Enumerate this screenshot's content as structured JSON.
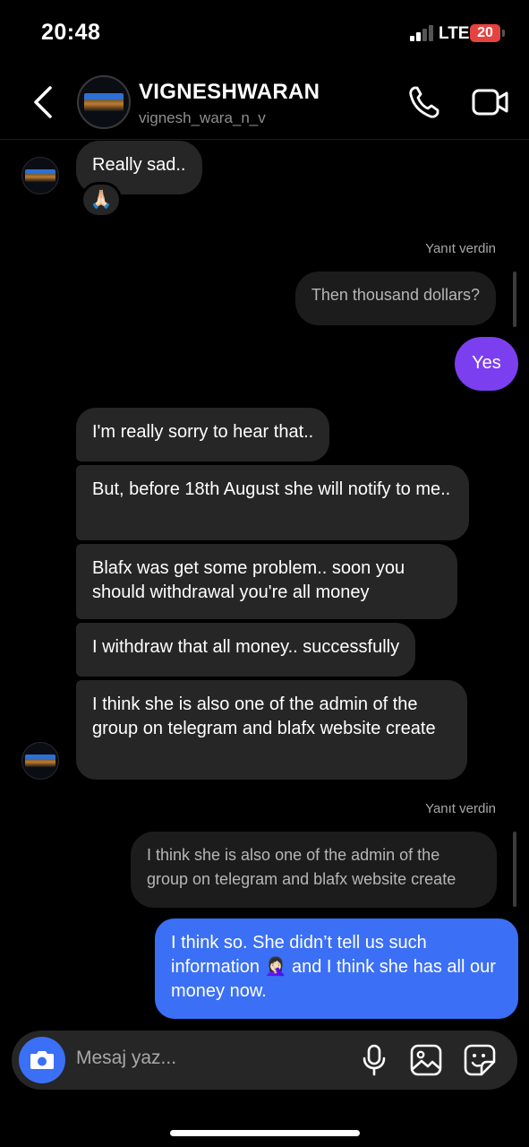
{
  "status_bar": {
    "time": "20:48",
    "network": "LTE",
    "battery": "20"
  },
  "header": {
    "name": "VIGNESHWARAN",
    "username": "vignesh_wara_n_v"
  },
  "messages": {
    "m1": "Really sad..",
    "reaction1": "🙏🏻",
    "replied_label_1": "Yanıt verdin",
    "quote1": "Then thousand dollars?",
    "out1": "Yes",
    "m2": "I'm really sorry to hear that..",
    "m3": "But, before 18th August she will notify to me..",
    "m4": "Blafx was get some problem.. soon you should withdrawal you're all money",
    "m5": "I withdraw that all money.. successfully",
    "m6": "I think she is also one of the admin of the group on telegram and blafx website create",
    "replied_label_2": "Yanıt verdin",
    "quote2": "I think she is also one of the admin of the group on telegram and blafx website create",
    "out2": "I think so. She didn’t tell us such information 🤦🏻‍♀️ and I think she has all our money now."
  },
  "composer": {
    "placeholder": "Mesaj yaz..."
  },
  "colors": {
    "accent_blue": "#3b6ff5",
    "accent_purple": "#7b3ff0",
    "incoming_bubble": "#262626",
    "battery_low": "#e5433f"
  },
  "icons": {
    "back": "chevron-left-icon",
    "call": "phone-icon",
    "video": "video-camera-icon",
    "camera": "camera-icon",
    "mic": "microphone-icon",
    "gallery": "image-gallery-icon",
    "sticker": "sticker-icon"
  }
}
